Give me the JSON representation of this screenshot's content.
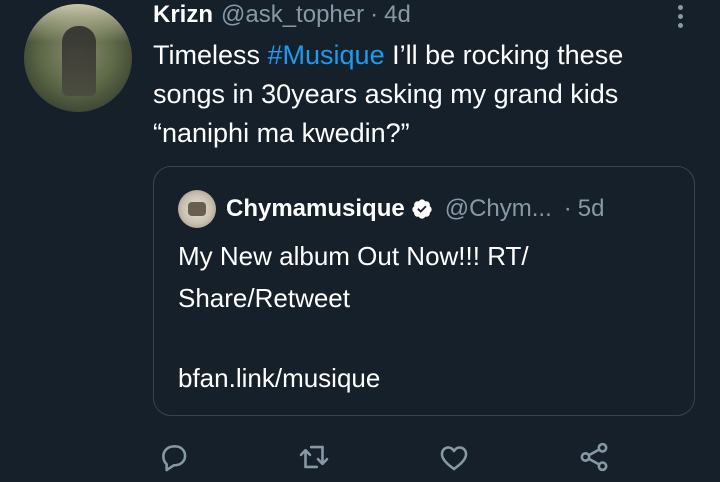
{
  "tweet": {
    "author_name": "Krizn",
    "author_handle": "@ask_topher",
    "separator": "·",
    "age": "4d",
    "text_before": "Timeless ",
    "hashtag": "#Musique",
    "text_after": " I’ll be rocking these songs in 30years asking my grand kids “naniphi ma kwedin?”"
  },
  "quoted_tweet": {
    "author_name": "Chymamusique",
    "author_handle": "@Chym...",
    "separator": "·",
    "age": "5d",
    "text": "My New album Out Now!!! RT/ Share/Retweet",
    "link": "bfan.link/musique"
  },
  "colors": {
    "background": "#15202b",
    "secondary_text": "#8899a6",
    "hashtag": "#1d9bf0",
    "border": "#38444d",
    "verified": "#ffffff"
  },
  "icons": [
    "more-icon",
    "verified-icon",
    "reply-icon",
    "retweet-icon",
    "like-icon",
    "share-icon"
  ]
}
